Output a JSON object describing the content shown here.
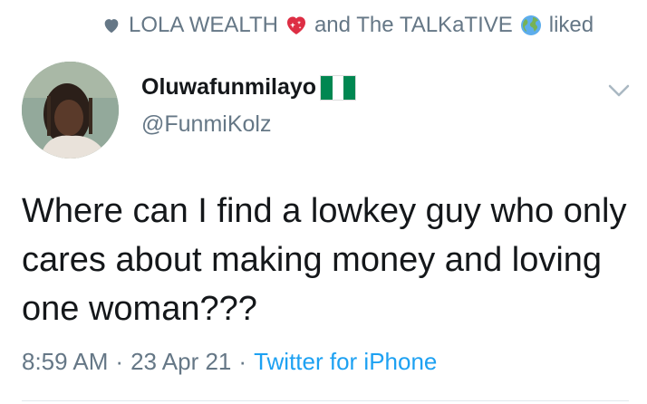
{
  "context": {
    "user1": "LOLA WEALTH",
    "conjunction": "and The TALKaTIVE",
    "action": "liked",
    "heart_color": "#657786",
    "user1_emoji": "sparkling-heart-icon",
    "user2_emoji": "globe-icon"
  },
  "author": {
    "display_name": "Oluwafunmilayo",
    "handle": "@FunmiKolz",
    "flag": "nigeria-flag-icon"
  },
  "tweet": {
    "text": "Where can I find a lowkey guy who only cares about making money and loving one woman???",
    "time": "8:59 AM",
    "separator1": "·",
    "date": "23 Apr 21",
    "separator2": "·",
    "source": "Twitter for iPhone"
  },
  "colors": {
    "secondary_text": "#657786",
    "link": "#1da1f2",
    "nigeria_green": "#008751"
  }
}
